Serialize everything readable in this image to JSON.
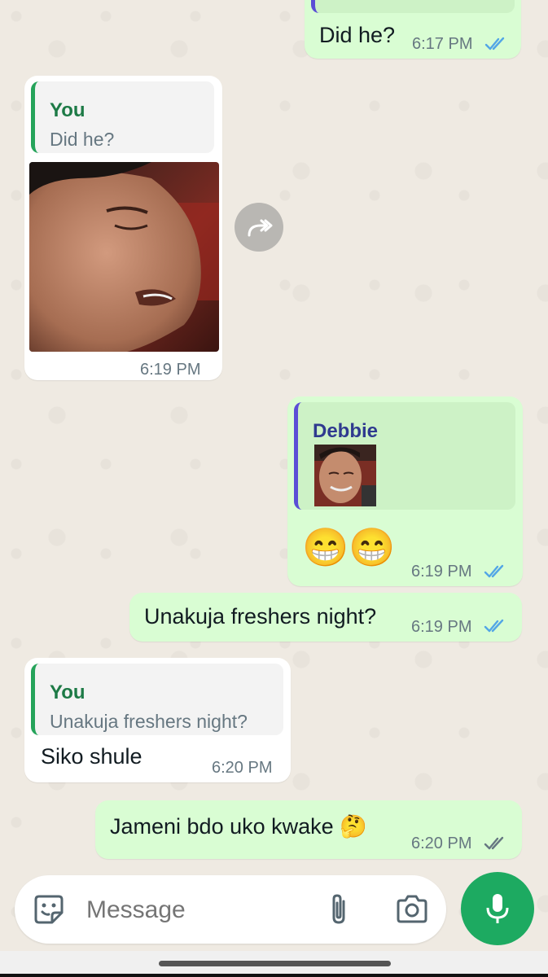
{
  "colors": {
    "outgoing_bubble": "#d9fdd3",
    "incoming_bubble": "#ffffff",
    "read_ticks": "#53a6e6",
    "delivered_ticks": "#667781",
    "mic_button": "#1daa61"
  },
  "messages": [
    {
      "direction": "outgoing",
      "text": "Did he?",
      "time": "6:17 PM",
      "status": "read"
    },
    {
      "direction": "incoming",
      "reply_to": {
        "author": "You",
        "text": "Did he?"
      },
      "media": "photo",
      "time": "6:19 PM",
      "forward_icon": "forward-icon"
    },
    {
      "direction": "outgoing",
      "reply_to": {
        "author": "Debbie",
        "media": "photo-thumbnail"
      },
      "text": "😁😁",
      "time": "6:19 PM",
      "status": "read"
    },
    {
      "direction": "outgoing",
      "text": "Unakuja freshers night?",
      "time": "6:19 PM",
      "status": "read"
    },
    {
      "direction": "incoming",
      "reply_to": {
        "author": "You",
        "text": "Unakuja freshers night?"
      },
      "text": "Siko shule",
      "time": "6:20 PM"
    },
    {
      "direction": "outgoing",
      "text": "Jameni bdo uko kwake 🤔",
      "time": "6:20 PM",
      "status": "delivered"
    }
  ],
  "composer": {
    "placeholder": "Message",
    "sticker_icon": "sticker-icon",
    "attach_icon": "paperclip-icon",
    "camera_icon": "camera-icon",
    "mic_icon": "mic-icon"
  }
}
